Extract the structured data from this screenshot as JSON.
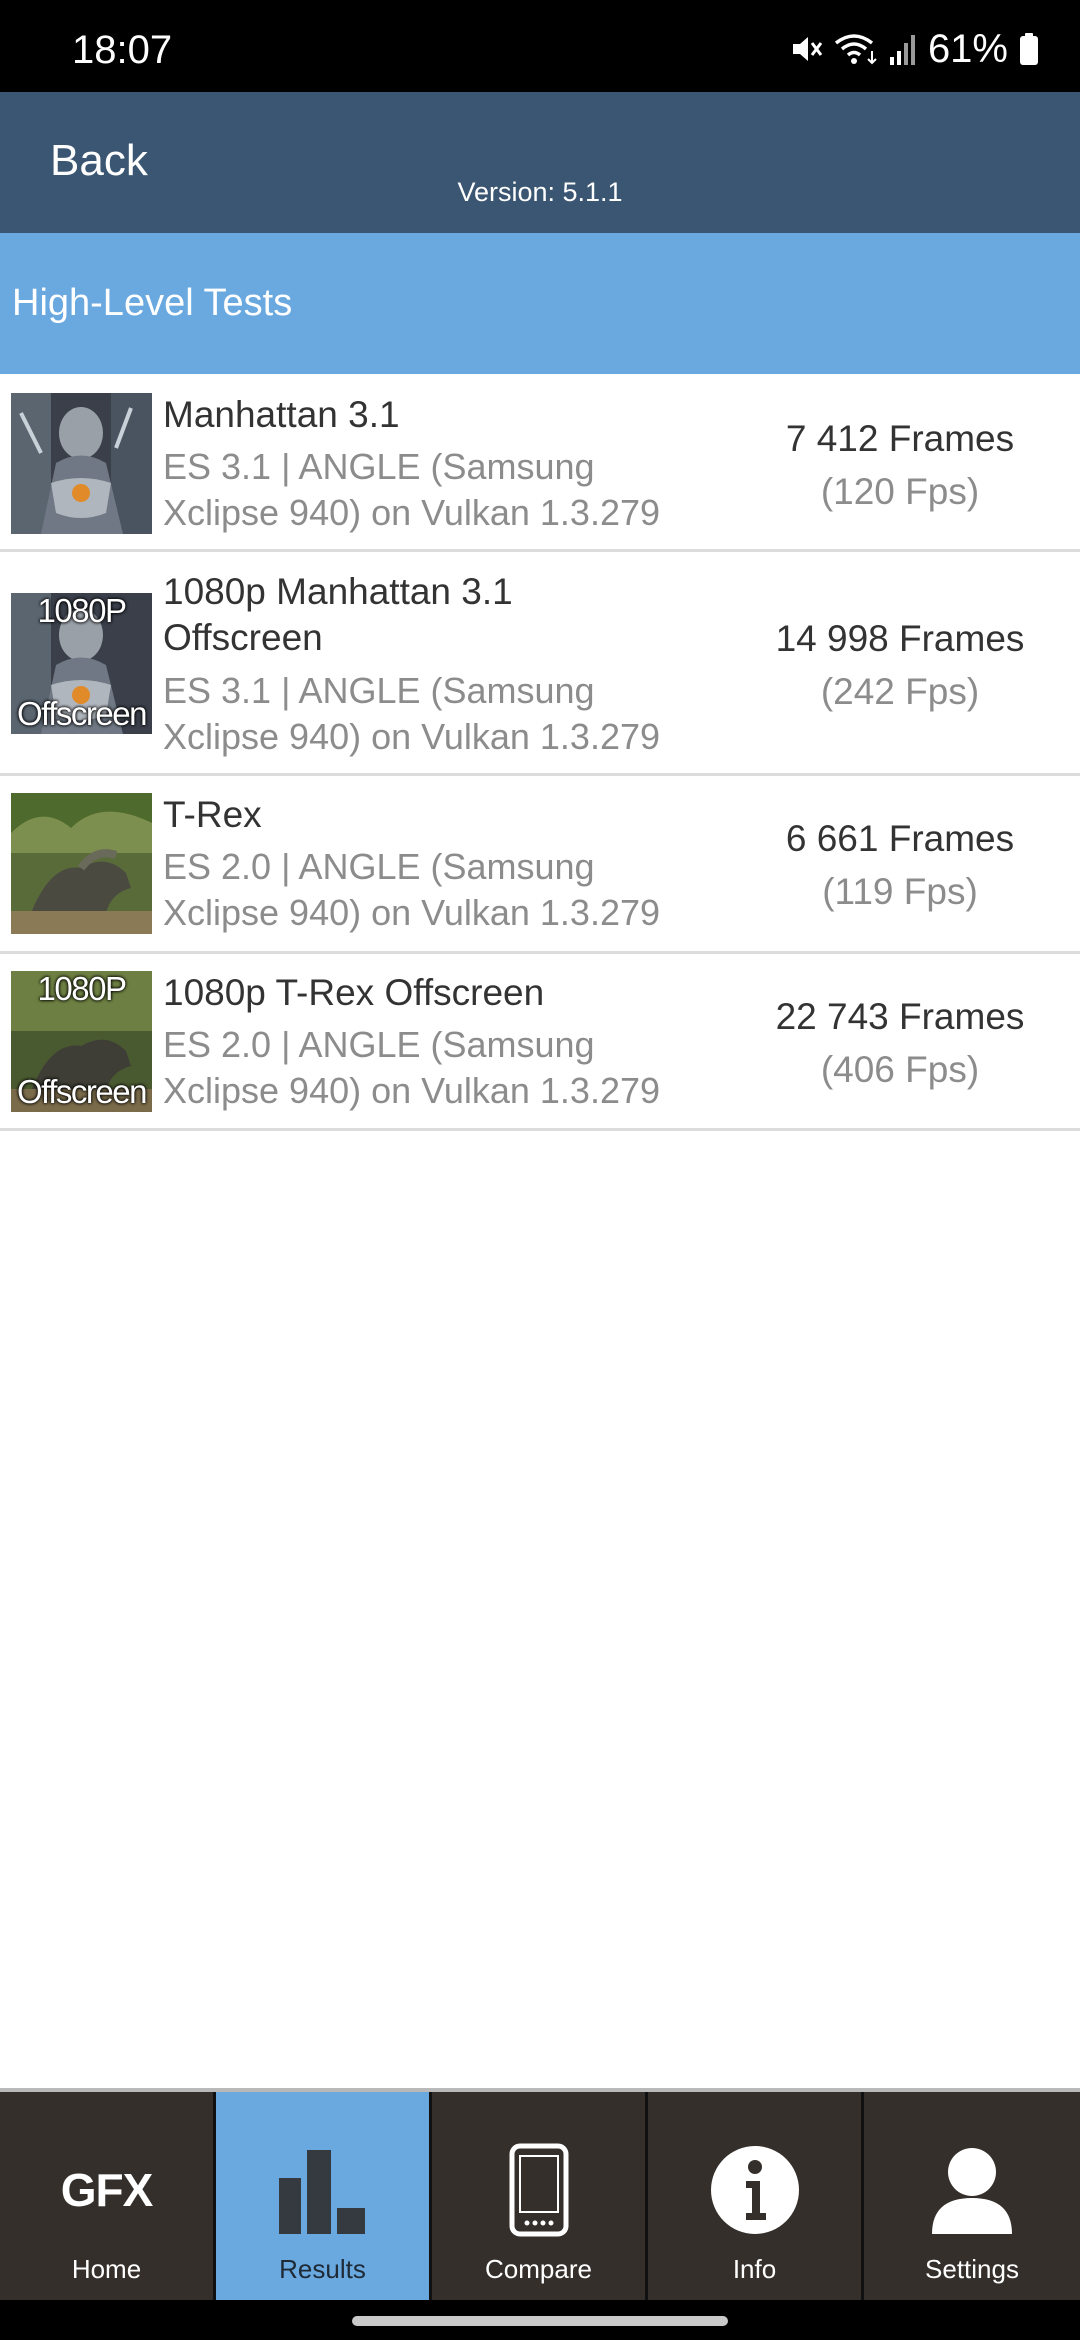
{
  "status_bar": {
    "time": "18:07",
    "battery": "61%",
    "icons": [
      "mute-icon",
      "wifi-icon",
      "signal-icon",
      "battery-icon"
    ]
  },
  "app_bar": {
    "back_label": "Back",
    "version": "Version: 5.1.1"
  },
  "section": {
    "title": "High-Level Tests"
  },
  "tests": [
    {
      "name": "Manhattan 3.1",
      "desc_line1": "ES 3.1 | ANGLE (Samsung",
      "desc_line2": "Xclipse 940) on Vulkan 1.3.279",
      "frames": "7 412 Frames",
      "fps": "(120 Fps)",
      "thumb_top": "",
      "thumb_bottom": ""
    },
    {
      "name_line1": "1080p Manhattan 3.1",
      "name_line2": "Offscreen",
      "desc_line1": "ES 3.1 | ANGLE (Samsung",
      "desc_line2": "Xclipse 940) on Vulkan 1.3.279",
      "frames": "14 998 Frames",
      "fps": "(242 Fps)",
      "thumb_top": "1080P",
      "thumb_bottom": "Offscreen"
    },
    {
      "name": "T-Rex",
      "desc_line1": "ES 2.0 | ANGLE (Samsung",
      "desc_line2": "Xclipse 940) on Vulkan 1.3.279",
      "frames": "6 661 Frames",
      "fps": "(119 Fps)",
      "thumb_top": "",
      "thumb_bottom": ""
    },
    {
      "name": "1080p T-Rex Offscreen",
      "desc_line1": "ES 2.0 | ANGLE (Samsung",
      "desc_line2": "Xclipse 940) on Vulkan 1.3.279",
      "frames": "22 743 Frames",
      "fps": "(406 Fps)",
      "thumb_top": "1080P",
      "thumb_bottom": "Offscreen"
    }
  ],
  "bottom_nav": {
    "items": [
      {
        "label": "Home",
        "icon": "gfx-logo-icon",
        "logo_text": "GFX",
        "active": false
      },
      {
        "label": "Results",
        "icon": "bar-chart-icon",
        "active": true
      },
      {
        "label": "Compare",
        "icon": "phone-icon",
        "active": false
      },
      {
        "label": "Info",
        "icon": "info-icon",
        "active": false
      },
      {
        "label": "Settings",
        "icon": "user-icon",
        "active": false
      }
    ]
  },
  "colors": {
    "app_bar": "#3a5672",
    "accent": "#6aa8e0",
    "nav_bg": "#342f2a"
  }
}
